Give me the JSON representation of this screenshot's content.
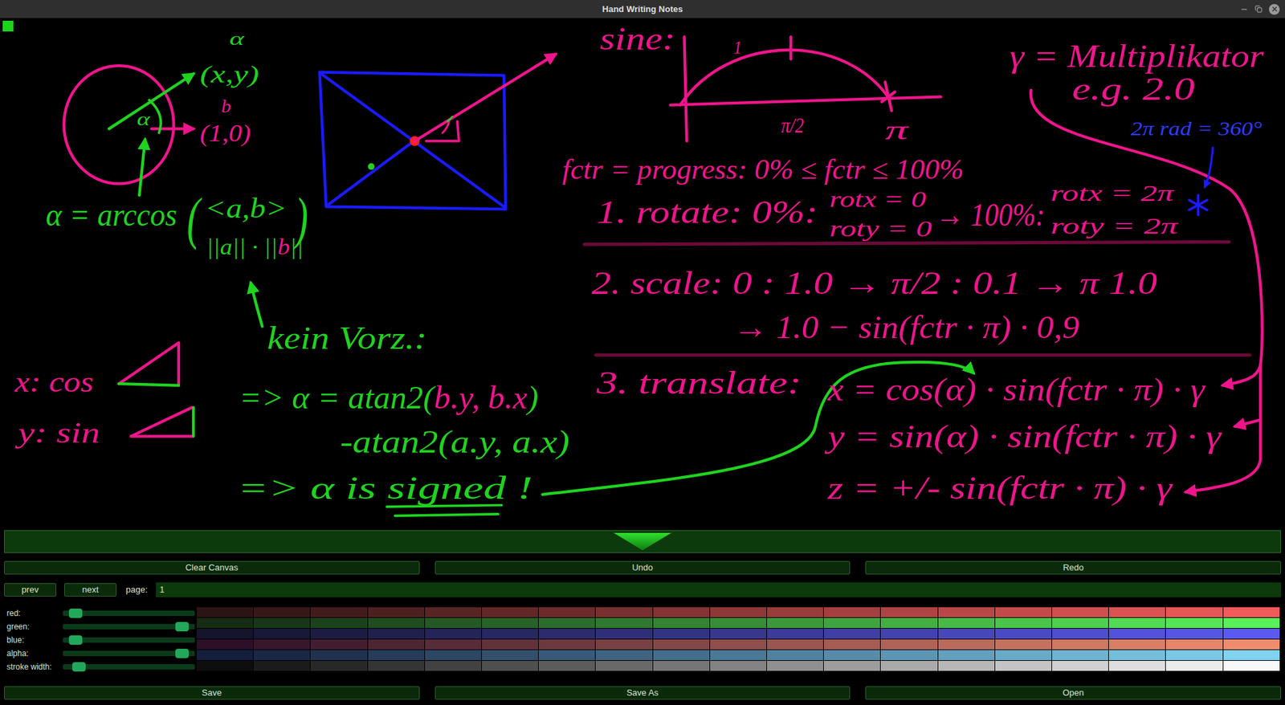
{
  "window": {
    "title": "Hand Writing Notes"
  },
  "brush": {
    "color": "#19d419"
  },
  "canvas": {
    "texts": [
      {
        "segments": [
          {
            "text": "α",
            "color": "#1fd31f"
          }
        ]
      },
      {
        "segments": [
          {
            "text": "(x,y)",
            "color": "#1fd31f"
          }
        ]
      },
      {
        "segments": [
          {
            "text": "b",
            "color": "#f0148c"
          }
        ]
      },
      {
        "segments": [
          {
            "text": "(1,0)",
            "color": "#f0148c"
          }
        ]
      },
      {
        "segments": [
          {
            "text": "α",
            "color": "#1fd31f"
          }
        ]
      },
      {
        "segments": [
          {
            "text": "α = arccos",
            "color": "#1fd31f"
          }
        ]
      },
      {
        "segments": [
          {
            "text": "(",
            "color": "#1fd31f"
          }
        ]
      },
      {
        "segments": [
          {
            "text": "<a,b>",
            "color": "#1fd31f"
          }
        ]
      },
      {
        "segments": [
          {
            "text": "||a|| · ||",
            "color": "#1fd31f"
          },
          {
            "text": "b",
            "color": "#f0148c"
          },
          {
            "text": "||",
            "color": "#1fd31f"
          }
        ]
      },
      {
        "segments": [
          {
            "text": ")",
            "color": "#1fd31f"
          }
        ]
      },
      {
        "segments": [
          {
            "text": "kein Vorz.:",
            "color": "#1fd31f"
          }
        ]
      },
      {
        "segments": [
          {
            "text": "x: cos",
            "color": "#f0148c"
          }
        ]
      },
      {
        "segments": [
          {
            "text": "y: sin",
            "color": "#f0148c"
          }
        ]
      },
      {
        "segments": [
          {
            "text": "=> α = atan2(",
            "color": "#1fd31f"
          },
          {
            "text": "b.y, b.x",
            "color": "#f0148c"
          },
          {
            "text": ")",
            "color": "#1fd31f"
          }
        ]
      },
      {
        "segments": [
          {
            "text": "-atan2(a.y, a.x)",
            "color": "#1fd31f"
          }
        ]
      },
      {
        "segments": [
          {
            "text": "=> α is signed !",
            "color": "#1fd31f"
          }
        ]
      },
      {
        "segments": [
          {
            "text": "sine:",
            "color": "#f0148c"
          }
        ]
      },
      {
        "segments": [
          {
            "text": "1",
            "color": "#f0148c"
          }
        ]
      },
      {
        "segments": [
          {
            "text": "π/2",
            "color": "#f0148c"
          }
        ]
      },
      {
        "segments": [
          {
            "text": "π",
            "color": "#f0148c"
          }
        ]
      },
      {
        "segments": [
          {
            "text": "fctr = progress: 0% ≤ fctr ≤ 100%",
            "color": "#f0148c"
          }
        ]
      },
      {
        "segments": [
          {
            "text": "γ = Multiplikator",
            "color": "#f0148c"
          }
        ]
      },
      {
        "segments": [
          {
            "text": "e.g. 2.0",
            "color": "#f0148c"
          }
        ]
      },
      {
        "segments": [
          {
            "text": "2π rad = 360°",
            "color": "#2d3cff"
          }
        ]
      },
      {
        "segments": [
          {
            "text": "1. rotate: 0%:",
            "color": "#f0148c"
          }
        ]
      },
      {
        "segments": [
          {
            "text": "rotx = 0",
            "color": "#f0148c"
          }
        ]
      },
      {
        "segments": [
          {
            "text": "roty = 0",
            "color": "#f0148c"
          }
        ]
      },
      {
        "segments": [
          {
            "text": "→ 100%:",
            "color": "#f0148c"
          }
        ]
      },
      {
        "segments": [
          {
            "text": "rotx = 2π",
            "color": "#f0148c"
          }
        ]
      },
      {
        "segments": [
          {
            "text": "roty = 2π",
            "color": "#f0148c"
          }
        ]
      },
      {
        "segments": [
          {
            "text": "2. scale: 0 : 1.0 → π/2 : 0.1 → π 1.0",
            "color": "#f0148c"
          }
        ]
      },
      {
        "segments": [
          {
            "text": "→ 1.0 − sin(fctr · π) · 0,9",
            "color": "#f0148c"
          }
        ]
      },
      {
        "segments": [
          {
            "text": "3. translate:",
            "color": "#f0148c"
          }
        ]
      },
      {
        "segments": [
          {
            "text": "x = cos(α) · sin(fctr · π) · γ",
            "color": "#f0148c"
          }
        ]
      },
      {
        "segments": [
          {
            "text": "y = sin(α) · sin(fctr · π) · γ",
            "color": "#f0148c"
          }
        ]
      },
      {
        "segments": [
          {
            "text": "z = +/- sin(fctr · π) · γ",
            "color": "#f0148c"
          }
        ]
      }
    ]
  },
  "edit_buttons": [
    "Clear Canvas",
    "Undo",
    "Redo"
  ],
  "pager": {
    "prev": "prev",
    "next": "next",
    "label": "page:",
    "value": "1"
  },
  "sliders": [
    {
      "label": "red:",
      "level": 0.05
    },
    {
      "label": "green:",
      "level": 0.95
    },
    {
      "label": "blue:",
      "level": 0.05
    },
    {
      "label": "alpha:",
      "level": 0.95
    },
    {
      "label": "stroke width:",
      "level": 0.08
    }
  ],
  "palette": [
    [
      "#2c1414",
      "#371818",
      "#421c1c",
      "#4d2020",
      "#582424",
      "#622727",
      "#6d2b2b",
      "#782f2f",
      "#833333",
      "#8e3737",
      "#993b3b",
      "#a43f3f",
      "#af4343",
      "#ba4747",
      "#c44a4a",
      "#cf4e4e",
      "#da5252",
      "#e55656",
      "#f05a5a"
    ],
    [
      "#142c14",
      "#183718",
      "#1c421c",
      "#204d20",
      "#245824",
      "#276227",
      "#2b6d2b",
      "#2f782f",
      "#338333",
      "#378e37",
      "#3b993b",
      "#3fa43f",
      "#43af43",
      "#47ba47",
      "#4ac44a",
      "#4ecf4e",
      "#52da52",
      "#56e556",
      "#5af05a"
    ],
    [
      "#14142c",
      "#181837",
      "#1c1c42",
      "#20204d",
      "#242458",
      "#272762",
      "#2b2b6d",
      "#2f2f78",
      "#333383",
      "#37378e",
      "#3b3b99",
      "#3f3fa4",
      "#4343af",
      "#4747ba",
      "#4a4ac4",
      "#4e4ecf",
      "#5252da",
      "#5656e5",
      "#5a5af0"
    ],
    [
      "#2c1028",
      "#37172c",
      "#421e30",
      "#4d2534",
      "#582c38",
      "#62323b",
      "#6d393f",
      "#784043",
      "#834747",
      "#8e4e4b",
      "#99554f",
      "#a45c53",
      "#af6357",
      "#ba6a5b",
      "#c4715f",
      "#cf7862",
      "#da7e66",
      "#e5856a",
      "#f08c6e"
    ],
    [
      "#141e3c",
      "#1a2846",
      "#203250",
      "#263c5a",
      "#2c4664",
      "#32506e",
      "#385a78",
      "#3e6482",
      "#446e8c",
      "#4a7896",
      "#5082a0",
      "#568caa",
      "#5c96b4",
      "#62a0be",
      "#68aac8",
      "#6eb4d2",
      "#74bedc",
      "#7ac8e6",
      "#80d2f0"
    ],
    [
      "#0e0e0e",
      "#1b1b1b",
      "#282828",
      "#353535",
      "#424242",
      "#4f4f4f",
      "#5c5c5c",
      "#696969",
      "#767676",
      "#838383",
      "#909090",
      "#9d9d9d",
      "#aaaaaa",
      "#b7b7b7",
      "#c4c4c4",
      "#d1d1d1",
      "#dedede",
      "#ebebeb",
      "#f8f8f8"
    ]
  ],
  "file_buttons": [
    "Save",
    "Save As",
    "Open"
  ]
}
